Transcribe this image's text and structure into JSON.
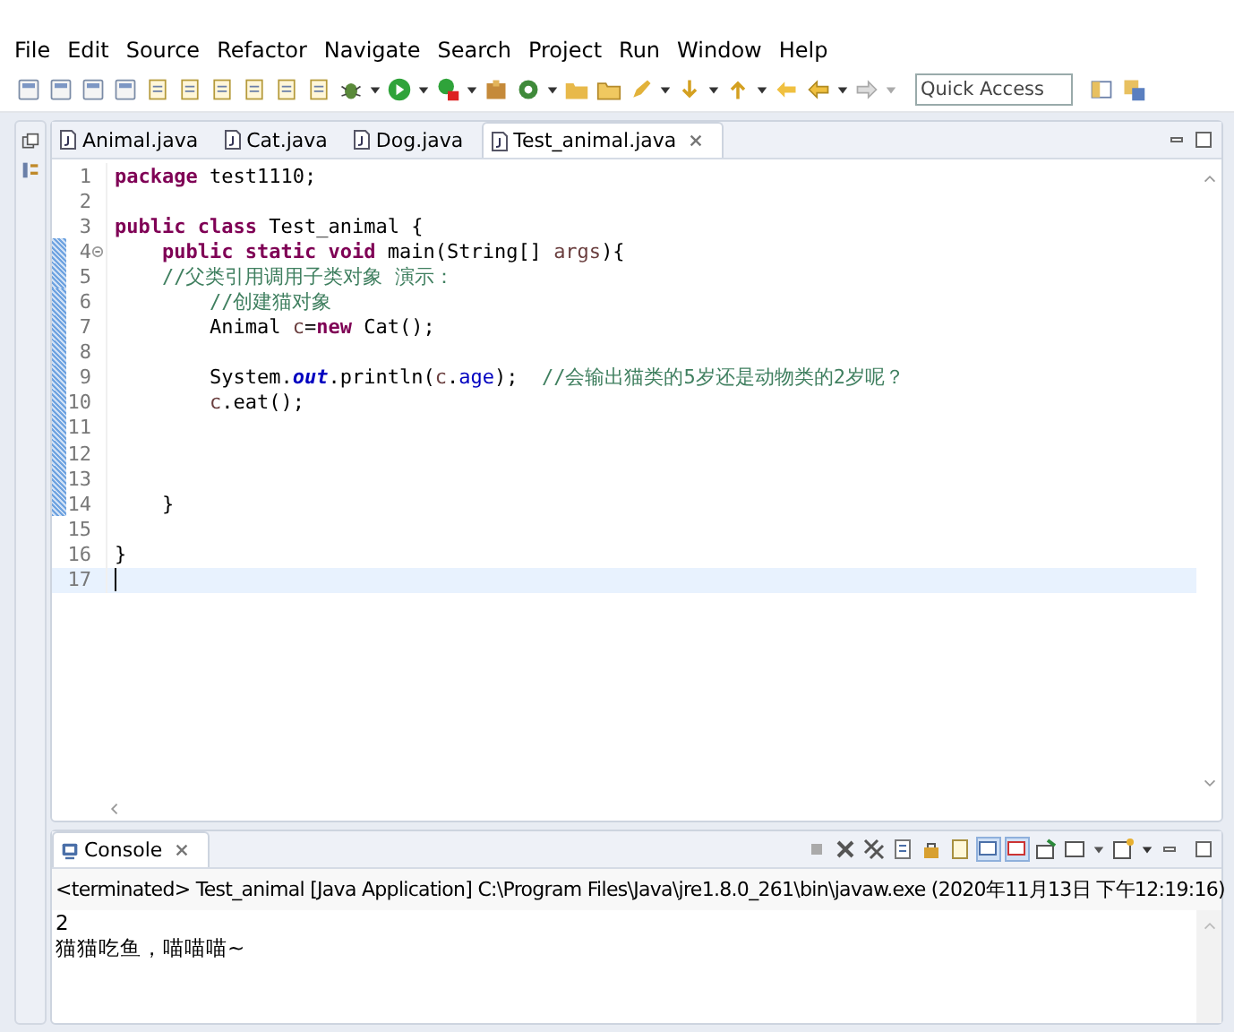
{
  "menu": [
    "File",
    "Edit",
    "Source",
    "Refactor",
    "Navigate",
    "Search",
    "Project",
    "Run",
    "Window",
    "Help"
  ],
  "quick_access": {
    "placeholder": "Quick Access"
  },
  "editor": {
    "tabs": [
      {
        "label": "Animal.java",
        "selected": false
      },
      {
        "label": "Cat.java",
        "selected": false
      },
      {
        "label": "Dog.java",
        "selected": false
      },
      {
        "label": "Test_animal.java",
        "selected": true
      }
    ],
    "lines": [
      {
        "number": "1",
        "changed": false,
        "current": false,
        "foldable": false,
        "tokens": [
          {
            "kind": "keyword",
            "text": "package"
          },
          {
            "kind": "plain",
            "text": " test1110;"
          }
        ]
      },
      {
        "number": "2",
        "changed": false,
        "current": false,
        "foldable": false
      },
      {
        "number": "3",
        "changed": false,
        "current": false,
        "foldable": false,
        "tokens": [
          {
            "kind": "keyword",
            "text": "public"
          },
          {
            "kind": "keyword",
            "text": " class"
          },
          {
            "kind": "plain",
            "text": " Test_animal {"
          }
        ]
      },
      {
        "number": "4",
        "changed": true,
        "current": false,
        "foldable": true,
        "tokens": [
          {
            "kind": "keyword",
            "text": "    public"
          },
          {
            "kind": "keyword",
            "text": " static"
          },
          {
            "kind": "keyword",
            "text": " void"
          },
          {
            "kind": "plain",
            "text": " main(String[] "
          },
          {
            "kind": "local",
            "text": "args"
          },
          {
            "kind": "plain",
            "text": "){"
          }
        ]
      },
      {
        "number": "5",
        "changed": true,
        "current": false,
        "foldable": false,
        "tokens": [
          {
            "kind": "comment",
            "text": "    //父类引用调用子类对象 演示："
          }
        ]
      },
      {
        "number": "6",
        "changed": true,
        "current": false,
        "foldable": false,
        "tokens": [
          {
            "kind": "comment",
            "text": "        //创建猫对象"
          }
        ]
      },
      {
        "number": "7",
        "changed": true,
        "current": false,
        "foldable": false,
        "tokens": [
          {
            "kind": "plain",
            "text": "        Animal "
          },
          {
            "kind": "local",
            "text": "c"
          },
          {
            "kind": "plain",
            "text": "="
          },
          {
            "kind": "keyword",
            "text": "new"
          },
          {
            "kind": "plain",
            "text": " Cat();"
          }
        ]
      },
      {
        "number": "8",
        "changed": true,
        "current": false,
        "foldable": false
      },
      {
        "number": "9",
        "changed": true,
        "current": false,
        "foldable": false,
        "tokens": [
          {
            "kind": "plain",
            "text": "        System."
          },
          {
            "kind": "static",
            "text": "out"
          },
          {
            "kind": "plain",
            "text": ".println("
          },
          {
            "kind": "local",
            "text": "c"
          },
          {
            "kind": "plain",
            "text": "."
          },
          {
            "kind": "field",
            "text": "age"
          },
          {
            "kind": "plain",
            "text": ");  "
          },
          {
            "kind": "comment",
            "text": "//会输出猫类的5岁还是动物类的2岁呢？"
          }
        ]
      },
      {
        "number": "10",
        "changed": true,
        "current": false,
        "foldable": false,
        "tokens": [
          {
            "kind": "local",
            "text": "        c"
          },
          {
            "kind": "plain",
            "text": ".eat();"
          }
        ]
      },
      {
        "number": "11",
        "changed": true,
        "current": false,
        "foldable": false
      },
      {
        "number": "12",
        "changed": true,
        "current": false,
        "foldable": false
      },
      {
        "number": "13",
        "changed": true,
        "current": false,
        "foldable": false
      },
      {
        "number": "14",
        "changed": true,
        "current": false,
        "foldable": false,
        "tokens": [
          {
            "kind": "plain",
            "text": "    }"
          }
        ]
      },
      {
        "number": "15",
        "changed": false,
        "current": false,
        "foldable": false
      },
      {
        "number": "16",
        "changed": false,
        "current": false,
        "foldable": false,
        "tokens": [
          {
            "kind": "plain",
            "text": "}"
          }
        ]
      },
      {
        "number": "17",
        "changed": false,
        "current": true,
        "foldable": false
      }
    ]
  },
  "console": {
    "tab": {
      "label": "Console",
      "selected": true
    },
    "header": "<terminated> Test_animal [Java Application] C:\\Program Files\\Java\\jre1.8.0_261\\bin\\javaw.exe (2020年11月13日 下午12:19:16)",
    "output": [
      "2",
      "猫猫吃鱼，喵喵喵~"
    ]
  }
}
